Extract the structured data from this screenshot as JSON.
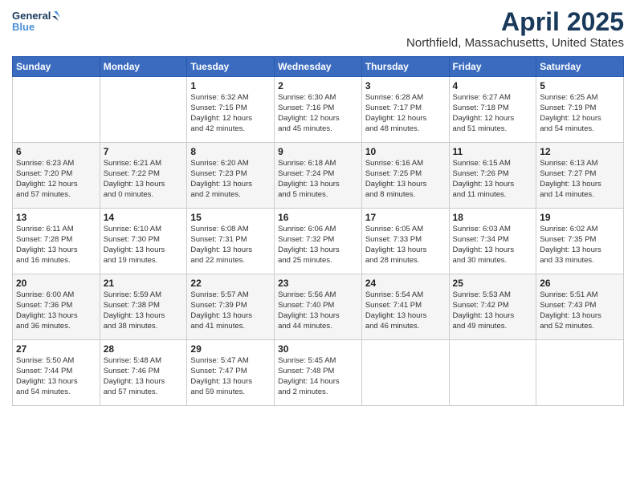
{
  "header": {
    "logo_line1": "General",
    "logo_line2": "Blue",
    "title": "April 2025",
    "subtitle": "Northfield, Massachusetts, United States"
  },
  "days_of_week": [
    "Sunday",
    "Monday",
    "Tuesday",
    "Wednesday",
    "Thursday",
    "Friday",
    "Saturday"
  ],
  "weeks": [
    [
      {
        "day": "",
        "info": ""
      },
      {
        "day": "",
        "info": ""
      },
      {
        "day": "1",
        "info": "Sunrise: 6:32 AM\nSunset: 7:15 PM\nDaylight: 12 hours\nand 42 minutes."
      },
      {
        "day": "2",
        "info": "Sunrise: 6:30 AM\nSunset: 7:16 PM\nDaylight: 12 hours\nand 45 minutes."
      },
      {
        "day": "3",
        "info": "Sunrise: 6:28 AM\nSunset: 7:17 PM\nDaylight: 12 hours\nand 48 minutes."
      },
      {
        "day": "4",
        "info": "Sunrise: 6:27 AM\nSunset: 7:18 PM\nDaylight: 12 hours\nand 51 minutes."
      },
      {
        "day": "5",
        "info": "Sunrise: 6:25 AM\nSunset: 7:19 PM\nDaylight: 12 hours\nand 54 minutes."
      }
    ],
    [
      {
        "day": "6",
        "info": "Sunrise: 6:23 AM\nSunset: 7:20 PM\nDaylight: 12 hours\nand 57 minutes."
      },
      {
        "day": "7",
        "info": "Sunrise: 6:21 AM\nSunset: 7:22 PM\nDaylight: 13 hours\nand 0 minutes."
      },
      {
        "day": "8",
        "info": "Sunrise: 6:20 AM\nSunset: 7:23 PM\nDaylight: 13 hours\nand 2 minutes."
      },
      {
        "day": "9",
        "info": "Sunrise: 6:18 AM\nSunset: 7:24 PM\nDaylight: 13 hours\nand 5 minutes."
      },
      {
        "day": "10",
        "info": "Sunrise: 6:16 AM\nSunset: 7:25 PM\nDaylight: 13 hours\nand 8 minutes."
      },
      {
        "day": "11",
        "info": "Sunrise: 6:15 AM\nSunset: 7:26 PM\nDaylight: 13 hours\nand 11 minutes."
      },
      {
        "day": "12",
        "info": "Sunrise: 6:13 AM\nSunset: 7:27 PM\nDaylight: 13 hours\nand 14 minutes."
      }
    ],
    [
      {
        "day": "13",
        "info": "Sunrise: 6:11 AM\nSunset: 7:28 PM\nDaylight: 13 hours\nand 16 minutes."
      },
      {
        "day": "14",
        "info": "Sunrise: 6:10 AM\nSunset: 7:30 PM\nDaylight: 13 hours\nand 19 minutes."
      },
      {
        "day": "15",
        "info": "Sunrise: 6:08 AM\nSunset: 7:31 PM\nDaylight: 13 hours\nand 22 minutes."
      },
      {
        "day": "16",
        "info": "Sunrise: 6:06 AM\nSunset: 7:32 PM\nDaylight: 13 hours\nand 25 minutes."
      },
      {
        "day": "17",
        "info": "Sunrise: 6:05 AM\nSunset: 7:33 PM\nDaylight: 13 hours\nand 28 minutes."
      },
      {
        "day": "18",
        "info": "Sunrise: 6:03 AM\nSunset: 7:34 PM\nDaylight: 13 hours\nand 30 minutes."
      },
      {
        "day": "19",
        "info": "Sunrise: 6:02 AM\nSunset: 7:35 PM\nDaylight: 13 hours\nand 33 minutes."
      }
    ],
    [
      {
        "day": "20",
        "info": "Sunrise: 6:00 AM\nSunset: 7:36 PM\nDaylight: 13 hours\nand 36 minutes."
      },
      {
        "day": "21",
        "info": "Sunrise: 5:59 AM\nSunset: 7:38 PM\nDaylight: 13 hours\nand 38 minutes."
      },
      {
        "day": "22",
        "info": "Sunrise: 5:57 AM\nSunset: 7:39 PM\nDaylight: 13 hours\nand 41 minutes."
      },
      {
        "day": "23",
        "info": "Sunrise: 5:56 AM\nSunset: 7:40 PM\nDaylight: 13 hours\nand 44 minutes."
      },
      {
        "day": "24",
        "info": "Sunrise: 5:54 AM\nSunset: 7:41 PM\nDaylight: 13 hours\nand 46 minutes."
      },
      {
        "day": "25",
        "info": "Sunrise: 5:53 AM\nSunset: 7:42 PM\nDaylight: 13 hours\nand 49 minutes."
      },
      {
        "day": "26",
        "info": "Sunrise: 5:51 AM\nSunset: 7:43 PM\nDaylight: 13 hours\nand 52 minutes."
      }
    ],
    [
      {
        "day": "27",
        "info": "Sunrise: 5:50 AM\nSunset: 7:44 PM\nDaylight: 13 hours\nand 54 minutes."
      },
      {
        "day": "28",
        "info": "Sunrise: 5:48 AM\nSunset: 7:46 PM\nDaylight: 13 hours\nand 57 minutes."
      },
      {
        "day": "29",
        "info": "Sunrise: 5:47 AM\nSunset: 7:47 PM\nDaylight: 13 hours\nand 59 minutes."
      },
      {
        "day": "30",
        "info": "Sunrise: 5:45 AM\nSunset: 7:48 PM\nDaylight: 14 hours\nand 2 minutes."
      },
      {
        "day": "",
        "info": ""
      },
      {
        "day": "",
        "info": ""
      },
      {
        "day": "",
        "info": ""
      }
    ]
  ]
}
